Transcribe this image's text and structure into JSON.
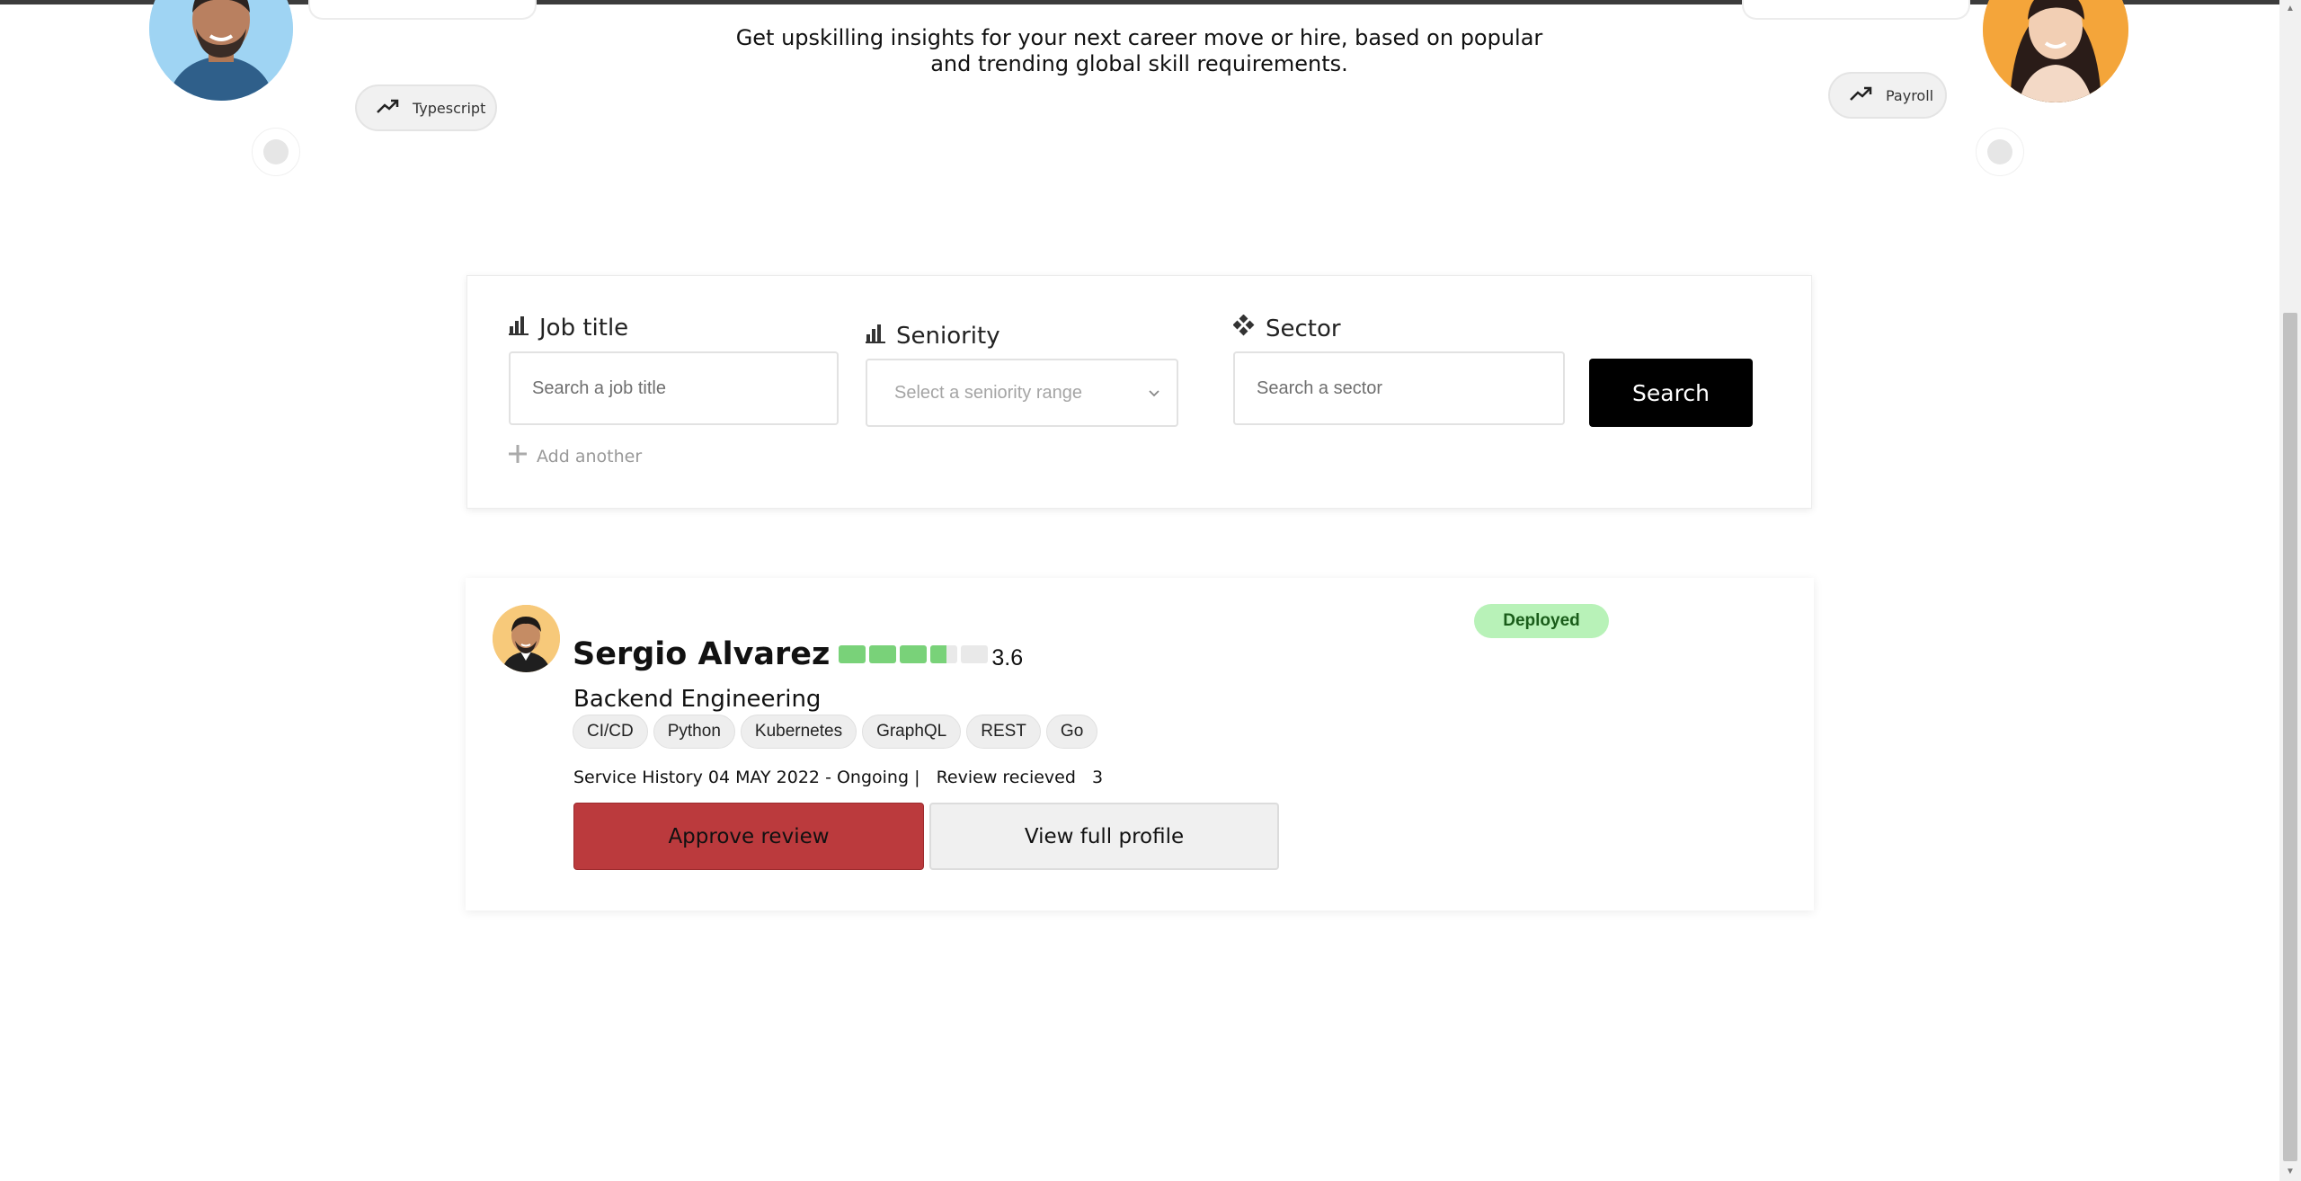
{
  "hero": {
    "tagline": "Get upskilling insights for your next career move or hire, based on popular and trending global skill requirements.",
    "trend_left": "Typescript",
    "trend_right": "Payroll"
  },
  "search": {
    "job_title_label": "Job title",
    "job_title_placeholder": "Search a job title",
    "seniority_label": "Seniority",
    "seniority_placeholder": "Select a seniority range",
    "sector_label": "Sector",
    "sector_placeholder": "Search a sector",
    "search_button": "Search",
    "add_another": "Add another"
  },
  "profile": {
    "name": "Sergio Alvarez",
    "rating": 3.6,
    "rating_display": "3.6",
    "rating_max": 5,
    "rating_color": "#79d279",
    "department": "Backend Engineering",
    "skills": [
      "CI/CD",
      "Python",
      "Kubernetes",
      "GraphQL",
      "REST",
      "Go"
    ],
    "service_history": "Service History 04 MAY 2022 - Ongoing |   Review recieved   3",
    "status": "Deployed",
    "status_color": "#b8f2b8",
    "approve_button": "Approve review",
    "approve_color": "#bb3a3d",
    "view_profile_button": "View full profile"
  }
}
